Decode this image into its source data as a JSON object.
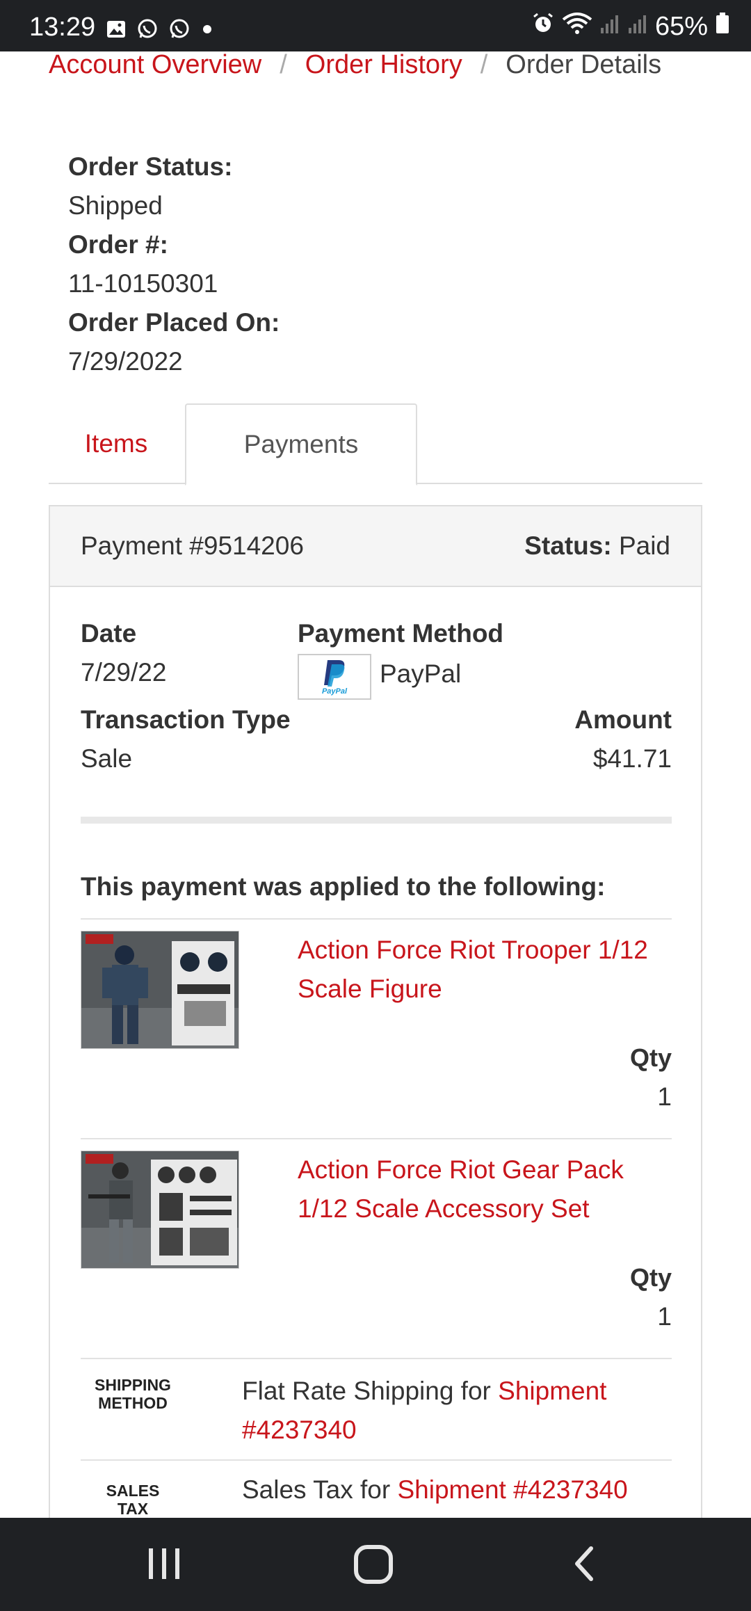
{
  "status_bar": {
    "time": "13:29",
    "battery": "65%",
    "left_icons": [
      "gallery-icon",
      "whatsapp-icon",
      "whatsapp-icon",
      "dot-icon"
    ],
    "right_icons": [
      "alarm-icon",
      "wifi-icon",
      "signal-icon",
      "signal-icon",
      "battery-icon"
    ]
  },
  "breadcrumb": {
    "items": [
      "Account Overview",
      "Order History",
      "Order Details"
    ],
    "separator": "/"
  },
  "order": {
    "status_label": "Order Status:",
    "status_value": "Shipped",
    "number_label": "Order #:",
    "number_value": "11-10150301",
    "placed_label": "Order Placed On:",
    "placed_value": "7/29/2022"
  },
  "tabs": {
    "items": "Items",
    "payments": "Payments",
    "active": "Payments"
  },
  "payment": {
    "title": "Payment #9514206",
    "status_label": "Status:",
    "status_value": "Paid",
    "date_label": "Date",
    "date_value": "7/29/22",
    "method_label": "Payment Method",
    "method_value": "PayPal",
    "type_label": "Transaction Type",
    "type_value": "Sale",
    "amount_label": "Amount",
    "amount_value": "$41.71",
    "applied_title": "This payment was applied to the following:"
  },
  "applied_items": [
    {
      "title": "Action Force Riot Trooper 1/12 Scale Figure",
      "qty_label": "Qty",
      "qty": "1",
      "image": "riot-trooper-figure-image"
    },
    {
      "title": "Action Force Riot Gear Pack 1/12 Scale Accessory Set",
      "qty_label": "Qty",
      "qty": "1",
      "image": "riot-gear-pack-image"
    }
  ],
  "fees": [
    {
      "label": "SHIPPING METHOD",
      "text": "Flat Rate Shipping for ",
      "link": "Shipment #4237340"
    },
    {
      "label": "SALES TAX",
      "text": "Sales Tax for ",
      "link": "Shipment #4237340"
    }
  ],
  "colors": {
    "accent": "#c8151b",
    "text": "#333333",
    "system_bar": "#1f2124",
    "panel_header": "#f5f5f5",
    "border": "#dddddd"
  }
}
